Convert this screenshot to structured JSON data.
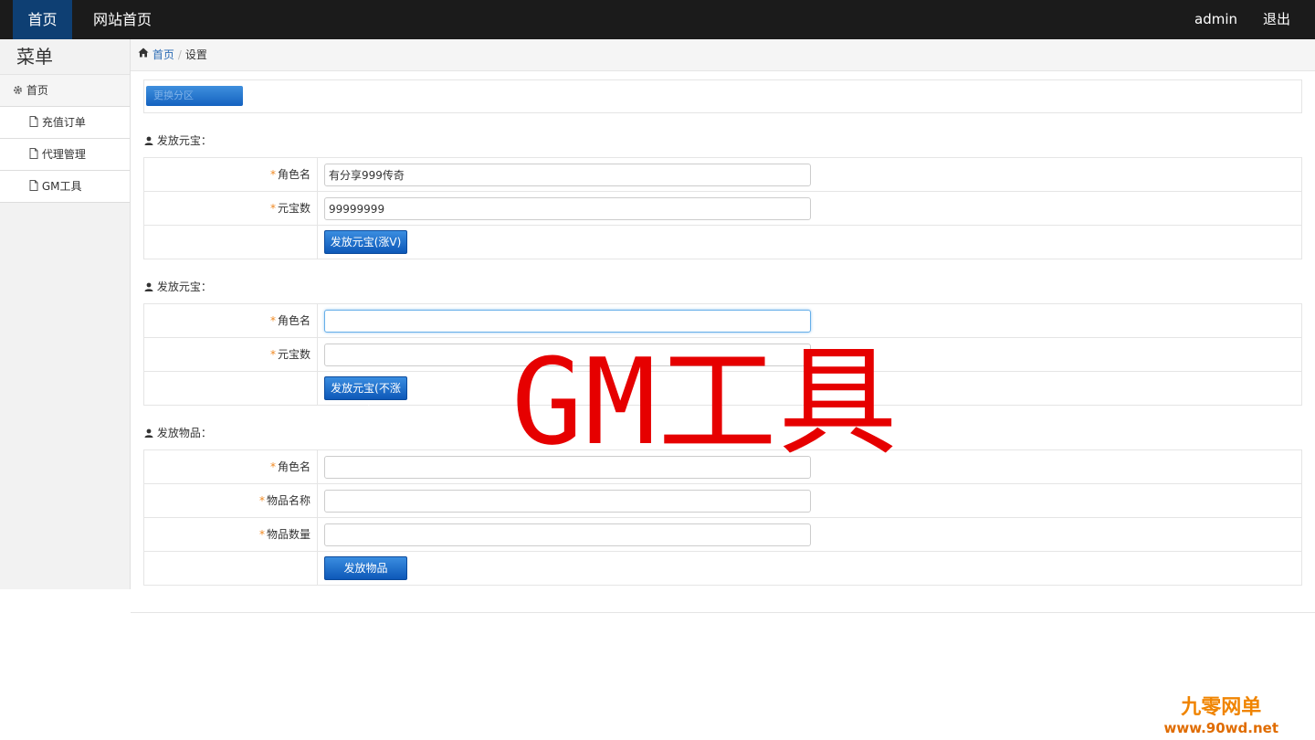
{
  "topbar": {
    "home": "首页",
    "site_home": "网站首页",
    "user": "admin",
    "logout": "退出"
  },
  "sidebar": {
    "title": "菜单",
    "items": [
      {
        "label": "首页",
        "icon": "gear-icon"
      },
      {
        "label": "充值订单",
        "icon": "file-icon"
      },
      {
        "label": "代理管理",
        "icon": "file-icon"
      },
      {
        "label": "GM工具",
        "icon": "file-icon"
      }
    ]
  },
  "breadcrumb": {
    "home": "首页",
    "sep": "/",
    "current": "设置"
  },
  "zone_button": "更换分区",
  "sections": [
    {
      "title": "发放元宝：",
      "fields": [
        {
          "label": "角色名",
          "value": "有分享999传奇"
        },
        {
          "label": "元宝数",
          "value": "99999999"
        }
      ],
      "button": "发放元宝(涨V)"
    },
    {
      "title": "发放元宝：",
      "fields": [
        {
          "label": "角色名",
          "value": ""
        },
        {
          "label": "元宝数",
          "value": ""
        }
      ],
      "button": "发放元宝(不涨V)"
    },
    {
      "title": "发放物品：",
      "fields": [
        {
          "label": "角色名",
          "value": ""
        },
        {
          "label": "物品名称",
          "value": ""
        },
        {
          "label": "物品数量",
          "value": ""
        }
      ],
      "button": "发放物品"
    }
  ],
  "required_mark": "*",
  "overlay_title": "GM工具",
  "watermark": {
    "line1": "九零网单",
    "line2": "www.90wd.net"
  },
  "colors": {
    "topbar": "#1b1b1b",
    "active_nav": "#0e3f73",
    "button": "#1462c0",
    "overlay": "#e60000",
    "watermark": "#f08400"
  }
}
